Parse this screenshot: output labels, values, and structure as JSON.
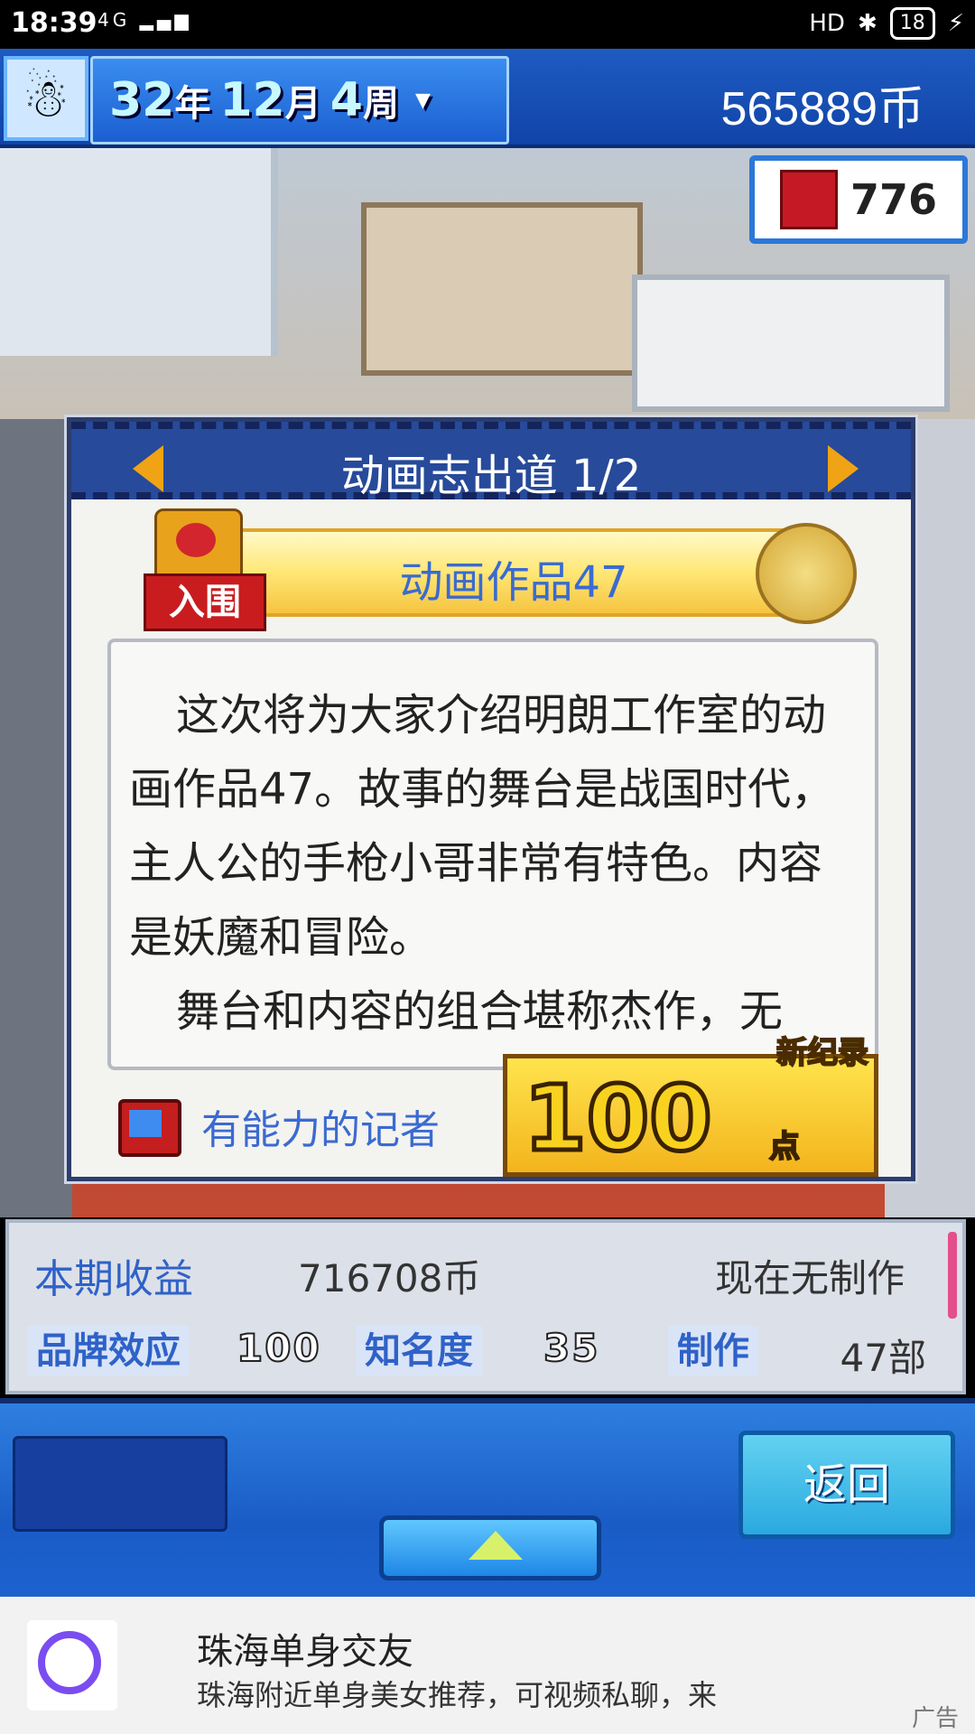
{
  "status_bar": {
    "time": "18:39",
    "signal_text": "4G",
    "network": "HD",
    "battery": "18"
  },
  "top_bar": {
    "year": "32",
    "year_unit": "年",
    "month": "12",
    "month_unit": "月",
    "week": "4",
    "week_unit": "周",
    "coins": "565889币",
    "magazine_count": "776"
  },
  "dialog": {
    "title": "动画志出道 1/2",
    "nominee_tag": "入围",
    "work_title": "动画作品47",
    "paragraph1": "这次将为大家介绍明朗工作室的动画作品47。故事的舞台是战国时代，主人公的手枪小哥非常有特色。内容是妖魔和冒险。",
    "paragraph2": "舞台和内容的组合堪称杰作，无",
    "reporter": "有能力的记者",
    "score": "100",
    "score_unit": "点",
    "new_record": "新纪录"
  },
  "info_panel": {
    "revenue_label": "本期收益",
    "revenue_value": "716708币",
    "production_status": "现在无制作",
    "brand_label": "品牌效应",
    "brand_value": "100",
    "fame_label": "知名度",
    "fame_value": "35",
    "works_label": "制作",
    "works_value": "47部"
  },
  "controls": {
    "back_label": "返回"
  },
  "ad": {
    "title": "珠海单身交友",
    "subtitle": "珠海附近单身美女推荐，可视频私聊，来",
    "tag": "广告"
  },
  "colors": {
    "accent_blue": "#2f62c8",
    "header_blue": "#274a9a",
    "arrow_orange": "#f0a314",
    "score_gold": "#f8d21e"
  }
}
